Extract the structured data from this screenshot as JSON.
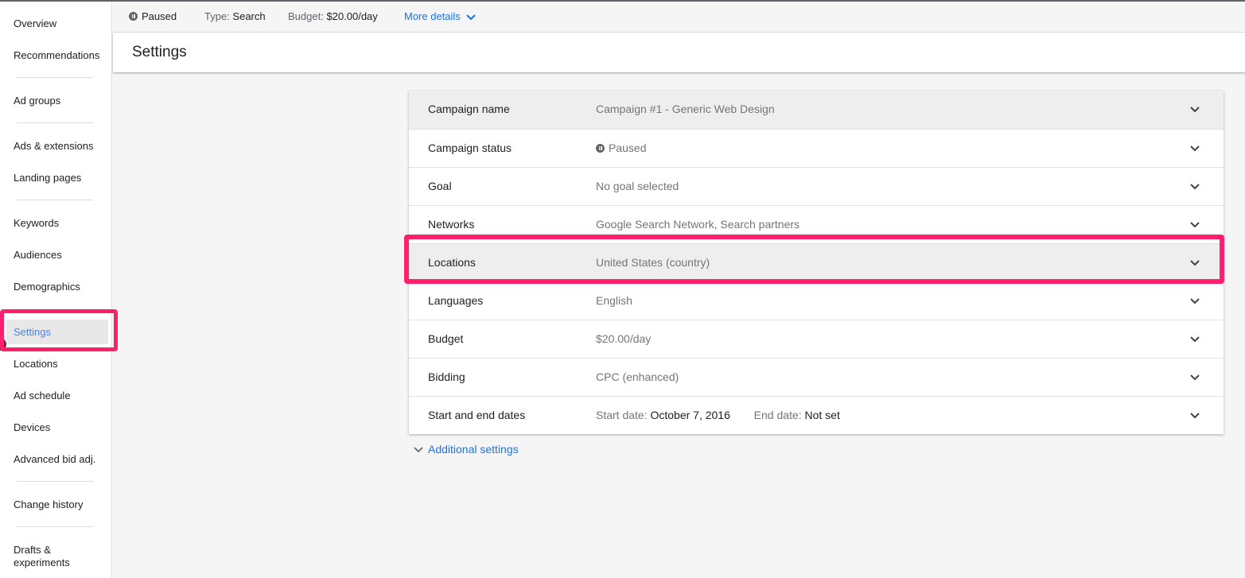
{
  "sidebar": {
    "items": [
      {
        "label": "Overview"
      },
      {
        "label": "Recommendations"
      },
      {
        "label": "Ad groups"
      },
      {
        "label": "Ads & extensions"
      },
      {
        "label": "Landing pages"
      },
      {
        "label": "Keywords"
      },
      {
        "label": "Audiences"
      },
      {
        "label": "Demographics"
      },
      {
        "label": "Settings",
        "active": true
      },
      {
        "label": "Locations"
      },
      {
        "label": "Ad schedule"
      },
      {
        "label": "Devices"
      },
      {
        "label": "Advanced bid adj."
      },
      {
        "label": "Change history"
      },
      {
        "label": "Drafts &",
        "label2": "experiments"
      }
    ]
  },
  "statusbar": {
    "status": "Paused",
    "type_label": "Type:",
    "type_value": "Search",
    "budget_label": "Budget:",
    "budget_value": "$20.00/day",
    "more_details": "More details"
  },
  "header": {
    "title": "Settings"
  },
  "settings": {
    "rows": [
      {
        "label": "Campaign name",
        "value": "Campaign #1 - Generic Web Design"
      },
      {
        "label": "Campaign status",
        "value": "Paused"
      },
      {
        "label": "Goal",
        "value": "No goal selected"
      },
      {
        "label": "Networks",
        "value": "Google Search Network, Search partners"
      },
      {
        "label": "Locations",
        "value": "United States (country)"
      },
      {
        "label": "Languages",
        "value": "English"
      },
      {
        "label": "Budget",
        "value": "$20.00/day"
      },
      {
        "label": "Bidding",
        "value": "CPC (enhanced)"
      },
      {
        "label": "Start and end dates",
        "start_label": "Start date:",
        "start_value": "October 7, 2016",
        "end_label": "End date:",
        "end_value": "Not set"
      }
    ],
    "additional": "Additional settings"
  },
  "colors": {
    "accent": "#1a73e8",
    "highlight": "#ff1f6b",
    "active_nav": "#4285f4"
  }
}
